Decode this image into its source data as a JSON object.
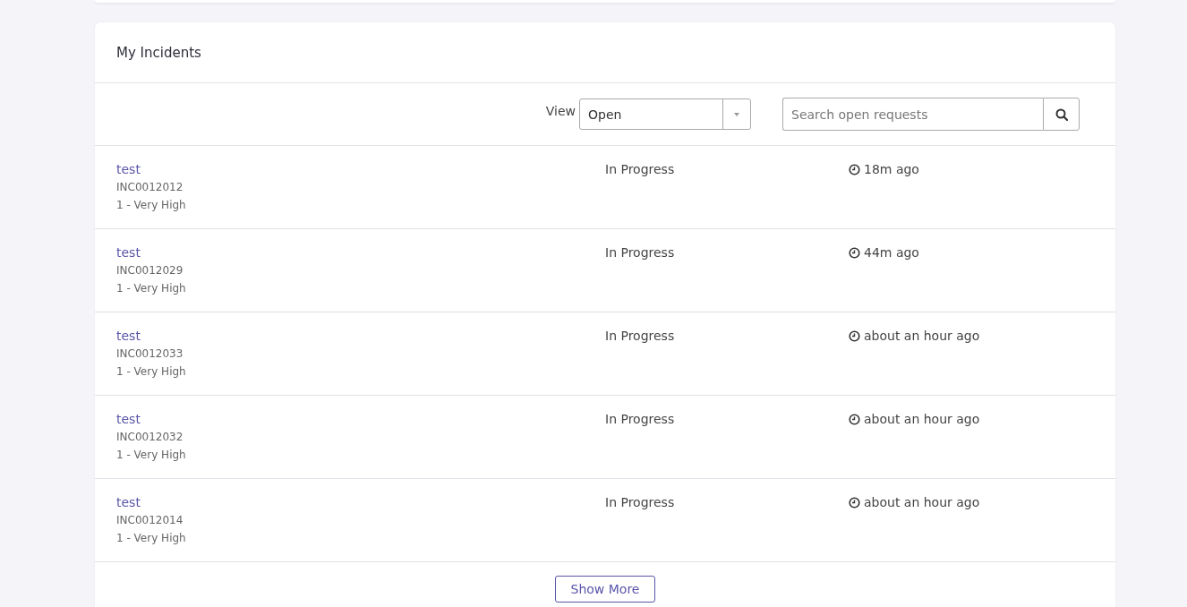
{
  "panel": {
    "title": "My Incidents"
  },
  "toolbar": {
    "view_label": "View",
    "view_value": "Open",
    "search": {
      "placeholder": "Search open requests"
    }
  },
  "incidents": [
    {
      "title": "test",
      "number": "INC0012012",
      "priority": "1 - Very High",
      "status": "In Progress",
      "updated": "18m ago"
    },
    {
      "title": "test",
      "number": "INC0012029",
      "priority": "1 - Very High",
      "status": "In Progress",
      "updated": "44m ago"
    },
    {
      "title": "test",
      "number": "INC0012033",
      "priority": "1 - Very High",
      "status": "In Progress",
      "updated": "about an hour ago"
    },
    {
      "title": "test",
      "number": "INC0012032",
      "priority": "1 - Very High",
      "status": "In Progress",
      "updated": "about an hour ago"
    },
    {
      "title": "test",
      "number": "INC0012014",
      "priority": "1 - Very High",
      "status": "In Progress",
      "updated": "about an hour ago"
    }
  ],
  "show_more": "Show More"
}
